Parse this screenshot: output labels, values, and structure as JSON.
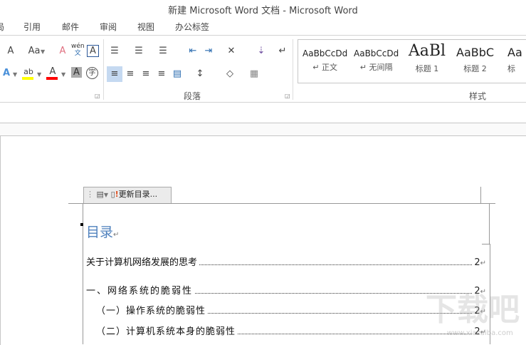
{
  "window": {
    "title": "新建 Microsoft Word 文档 - Microsoft Word"
  },
  "tabs": [
    "局",
    "引用",
    "邮件",
    "审阅",
    "视图",
    "办公标签"
  ],
  "ribbon": {
    "font_icons": {
      "grow_font": "A",
      "change_case": "Aa",
      "clear_format": "A",
      "phonetic": "wén",
      "phonetic_sub": "文",
      "char_border": "A",
      "text_effect": "A",
      "highlight": "ab",
      "font_color": "A",
      "char_shading": "A",
      "enclose": "字"
    },
    "groups": {
      "paragraph": "段落",
      "styles": "样式"
    },
    "styles": [
      {
        "preview": "AaBbCcDd",
        "name": "↵ 正文"
      },
      {
        "preview": "AaBbCcDd",
        "name": "↵ 无间隔"
      },
      {
        "preview": "AaBl",
        "name": "标题 1"
      },
      {
        "preview": "AaBbC",
        "name": "标题 2"
      },
      {
        "preview": "Aa",
        "name": "标"
      }
    ],
    "colors": {
      "highlight": "#ffff00",
      "font_color": "#ff0000",
      "selected": "#c5d9f1"
    }
  },
  "toc_toolbar": {
    "update_label": "更新目录..."
  },
  "document": {
    "toc_title": "目录",
    "entries": [
      {
        "text": "关于计算机网络发展的思考",
        "page": "2"
      },
      {
        "text": "一、网络系统的脆弱性",
        "page": "2"
      },
      {
        "text": "（一）操作系统的脆弱性",
        "page": "2"
      },
      {
        "text": "（二）计算机系统本身的脆弱性",
        "page": "2"
      }
    ]
  },
  "watermark": {
    "text": "下载吧",
    "url": "www.xiazaiba.com"
  }
}
